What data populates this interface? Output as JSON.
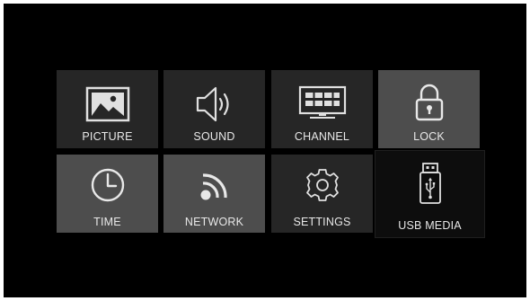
{
  "menu": {
    "items": [
      {
        "id": "picture",
        "label": "PICTURE",
        "icon": "picture-icon"
      },
      {
        "id": "sound",
        "label": "SOUND",
        "icon": "speaker-icon"
      },
      {
        "id": "channel",
        "label": "CHANNEL",
        "icon": "tv-channel-icon"
      },
      {
        "id": "lock",
        "label": "LOCK",
        "icon": "padlock-icon"
      },
      {
        "id": "time",
        "label": "TIME",
        "icon": "clock-icon"
      },
      {
        "id": "network",
        "label": "NETWORK",
        "icon": "wifi-signal-icon"
      },
      {
        "id": "settings",
        "label": "SETTINGS",
        "icon": "gear-icon"
      },
      {
        "id": "usb_media",
        "label": "USB MEDIA",
        "icon": "usb-drive-icon"
      }
    ],
    "selected": "usb_media"
  },
  "colors": {
    "screen_background": "#000000",
    "tile_dark": "#262626",
    "tile_light": "#4d4d4d",
    "tile_selected": "#0d0d0d",
    "icon_color": "#e0e0e0"
  }
}
